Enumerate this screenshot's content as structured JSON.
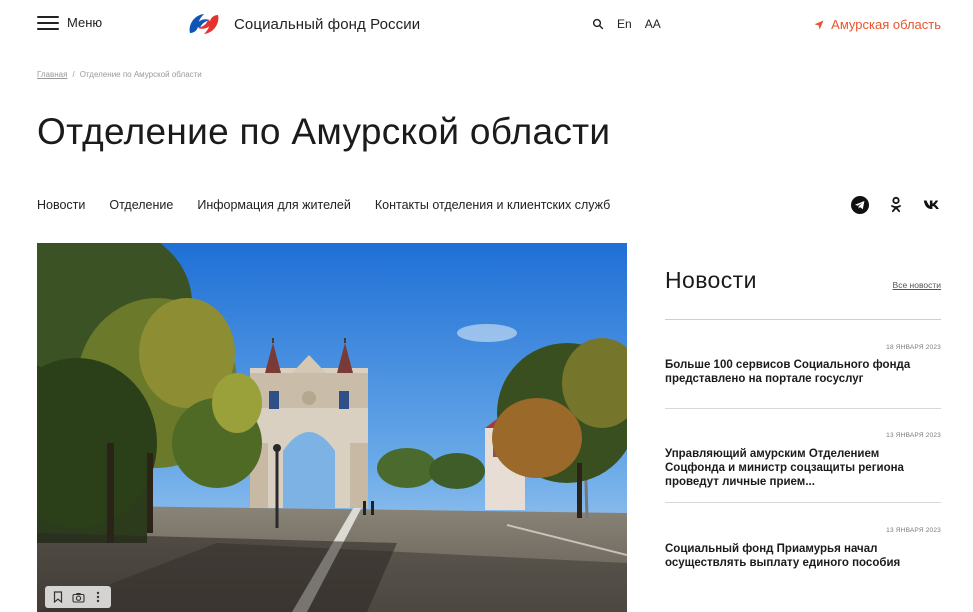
{
  "header": {
    "menu_label": "Меню",
    "logo_text": "Социальный фонд России",
    "lang_label": "En",
    "font_size_label": "AA",
    "region_label": "Амурская область",
    "accent_color": "#e8542d",
    "logo_colors": [
      "#0e55b6",
      "#e5322f"
    ]
  },
  "breadcrumb": {
    "home": "Главная",
    "separator": "/",
    "current": "Отделение по Амурской области"
  },
  "page_title": "Отделение по Амурской области",
  "subnav": [
    "Новости",
    "Отделение",
    "Информация для жителей",
    "Контакты отделения и клиентских служб"
  ],
  "socials": [
    "telegram-icon",
    "odnoklassniki-icon",
    "vk-icon"
  ],
  "hero": {
    "tool_icons": [
      "bookmark-icon",
      "camera-icon",
      "more-vertical-icon"
    ]
  },
  "news": {
    "title": "Новости",
    "all_link": "Все новости",
    "items": [
      {
        "date": "18 ЯНВАРЯ 2023",
        "text": "Больше 100 сервисов Социального фонда представлено на портале госуслуг"
      },
      {
        "date": "13 ЯНВАРЯ 2023",
        "text": "Управляющий амурским Отделением Соцфонда и министр соцзащиты региона проведут личные прием..."
      },
      {
        "date": "13 ЯНВАРЯ 2023",
        "text": "Социальный фонд Приамурья начал осуществлять выплату единого пособия"
      }
    ]
  }
}
